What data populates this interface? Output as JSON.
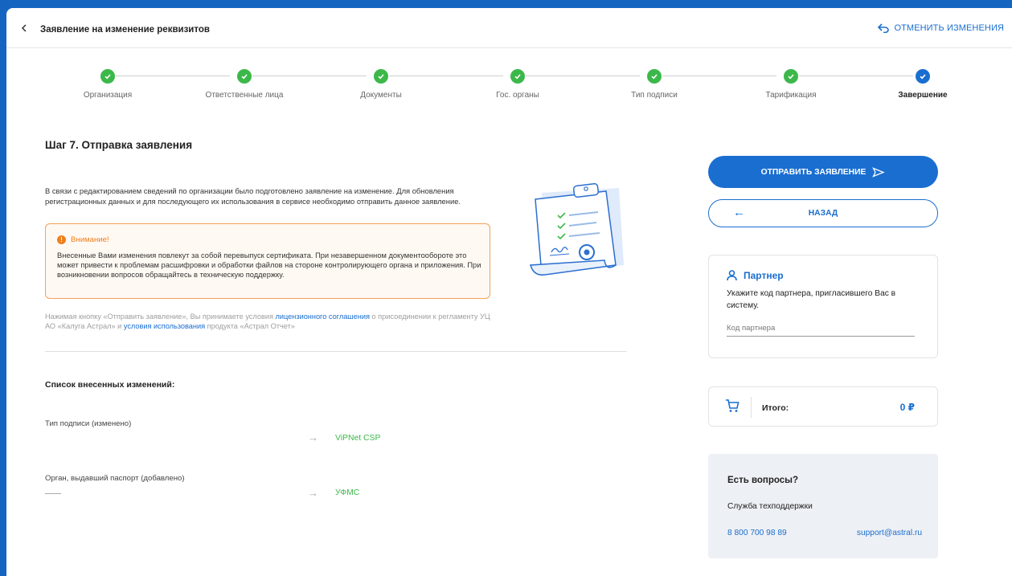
{
  "header": {
    "title": "Заявление на изменение реквизитов",
    "cancel_label": "ОТМЕНИТЬ ИЗМЕНЕНИЯ"
  },
  "stepper": {
    "steps": [
      {
        "label": "Организация",
        "state": "done"
      },
      {
        "label": "Ответственные лица",
        "state": "done"
      },
      {
        "label": "Документы",
        "state": "done"
      },
      {
        "label": "Гос. органы",
        "state": "done"
      },
      {
        "label": "Тип подписи",
        "state": "done"
      },
      {
        "label": "Тарификация",
        "state": "done"
      },
      {
        "label": "Завершение",
        "state": "current"
      }
    ]
  },
  "main": {
    "heading": "Шаг 7. Отправка заявления",
    "intro": "В связи с редактированием сведений по организации было подготовлено заявление на изменение. Для обновления регистрационных данных и для последующего их использования в сервисе необходимо отправить данное заявление.",
    "warning": {
      "title": "Внимание!",
      "text": "Внесенные Вами изменения повлекут за собой перевыпуск сертификата. При незавершенном документообороте это может привести к проблемам расшифровки и обработки файлов на стороне контролирующего органа и приложения. При возникновении вопросов обращайтесь в техническую поддержку."
    },
    "legal": {
      "part1": "Нажимая кнопку «Отправить заявление», Вы принимаете условия ",
      "link1": "лицензионного соглашения",
      "part2": " о присоединении к регламенту УЦ АО «Калуга Астрал» и ",
      "link2": "условия использования",
      "part3": " продукта «Астрал Отчет»"
    },
    "changes_title": "Список внесенных изменений:",
    "changes": [
      {
        "label": "Тип подписи (изменено)",
        "new_value": "ViPNet CSP"
      },
      {
        "label": "Орган, выдавший паспорт (добавлено)",
        "new_value": "УФМС"
      }
    ],
    "arrow_glyph": "→"
  },
  "actions": {
    "send_label": "ОТПРАВИТЬ ЗАЯВЛЕНИЕ",
    "back_label": "НАЗАД"
  },
  "partner": {
    "title": "Партнер",
    "text": "Укажите код партнера, пригласившего Вас в систему.",
    "input_placeholder": "Код партнера",
    "input_value": ""
  },
  "total": {
    "label": "Итого:",
    "value": "0 ₽"
  },
  "help": {
    "title": "Есть вопросы?",
    "subtitle": "Служба техподдержки",
    "phone": "8 800 700 98 89",
    "email": "support@astral.ru"
  },
  "colors": {
    "primary": "#1a6ed0",
    "success": "#3cb84a",
    "warning": "#f07f1b",
    "frame": "#1565c0"
  },
  "icons": [
    "chevron-left-icon",
    "undo-icon",
    "check-icon",
    "warning-icon",
    "clipboard-illustration",
    "send-icon",
    "arrow-left-icon",
    "user-icon",
    "cart-icon"
  ]
}
